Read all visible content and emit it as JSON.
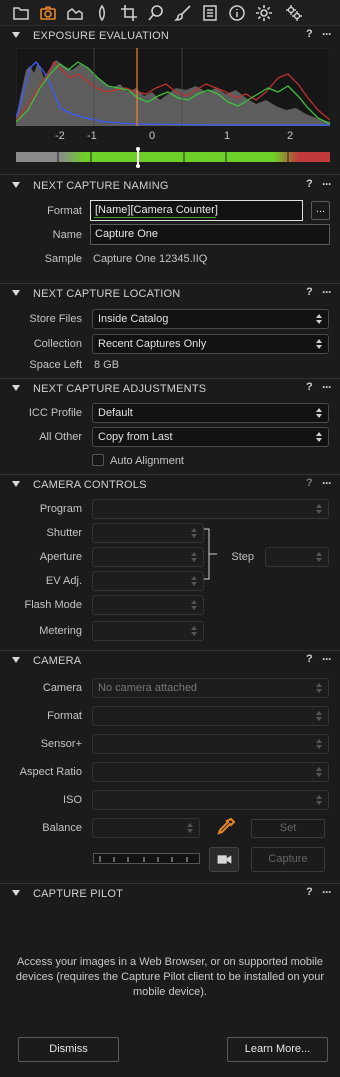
{
  "toolbar": {
    "tools": [
      {
        "icon": "folder-icon"
      },
      {
        "icon": "camera-icon",
        "active": true
      },
      {
        "icon": "layers-icon"
      },
      {
        "icon": "drop-icon"
      },
      {
        "icon": "crop-icon"
      },
      {
        "icon": "search-icon"
      },
      {
        "icon": "brush-icon"
      },
      {
        "icon": "list-icon"
      },
      {
        "icon": "info-icon"
      },
      {
        "icon": "gear-icon"
      },
      {
        "icon": "gears-icon"
      }
    ]
  },
  "exposure": {
    "title": "EXPOSURE EVALUATION",
    "help": "?",
    "more": "···",
    "scale": [
      "-2",
      "-1",
      "0",
      "1",
      "2"
    ]
  },
  "naming": {
    "title": "NEXT CAPTURE NAMING",
    "help": "?",
    "more": "···",
    "format_label": "Format",
    "format_value": "[Name][Camera Counter]",
    "format_button": "...",
    "name_label": "Name",
    "name_value": "Capture One",
    "sample_label": "Sample",
    "sample_value": "Capture One 12345.IIQ"
  },
  "location": {
    "title": "NEXT CAPTURE LOCATION",
    "help": "?",
    "more": "···",
    "store_label": "Store Files",
    "store_value": "Inside Catalog",
    "collection_label": "Collection",
    "collection_value": "Recent Captures Only",
    "space_label": "Space Left",
    "space_value": "8 GB"
  },
  "adjustments": {
    "title": "NEXT CAPTURE ADJUSTMENTS",
    "help": "?",
    "more": "···",
    "icc_label": "ICC Profile",
    "icc_value": "Default",
    "other_label": "All Other",
    "other_value": "Copy from Last",
    "auto_alignment": "Auto Alignment"
  },
  "camera_controls": {
    "title": "CAMERA CONTROLS",
    "help": "?",
    "more": "···",
    "program": "Program",
    "shutter": "Shutter",
    "aperture": "Aperture",
    "ev": "EV Adj.",
    "flash": "Flash Mode",
    "metering": "Metering",
    "step": "Step"
  },
  "camera": {
    "title": "CAMERA",
    "help": "?",
    "more": "···",
    "camera_label": "Camera",
    "camera_value": "No camera attached",
    "format_label": "Format",
    "sensor_label": "Sensor+",
    "aspect_label": "Aspect Ratio",
    "iso_label": "ISO",
    "balance_label": "Balance",
    "set_button": "Set",
    "capture_button": "Capture"
  },
  "pilot": {
    "title": "CAPTURE PILOT",
    "help": "?",
    "more": "···",
    "text": "Access your images in a Web Browser, or on supported mobile devices (requires the Capture Pilot client to be installed on your mobile device).",
    "dismiss": "Dismiss",
    "learn_more": "Learn More..."
  },
  "colors": {
    "accent": "#e8862b",
    "meter_green": "#6fd02a",
    "meter_red": "#c23a3a"
  }
}
